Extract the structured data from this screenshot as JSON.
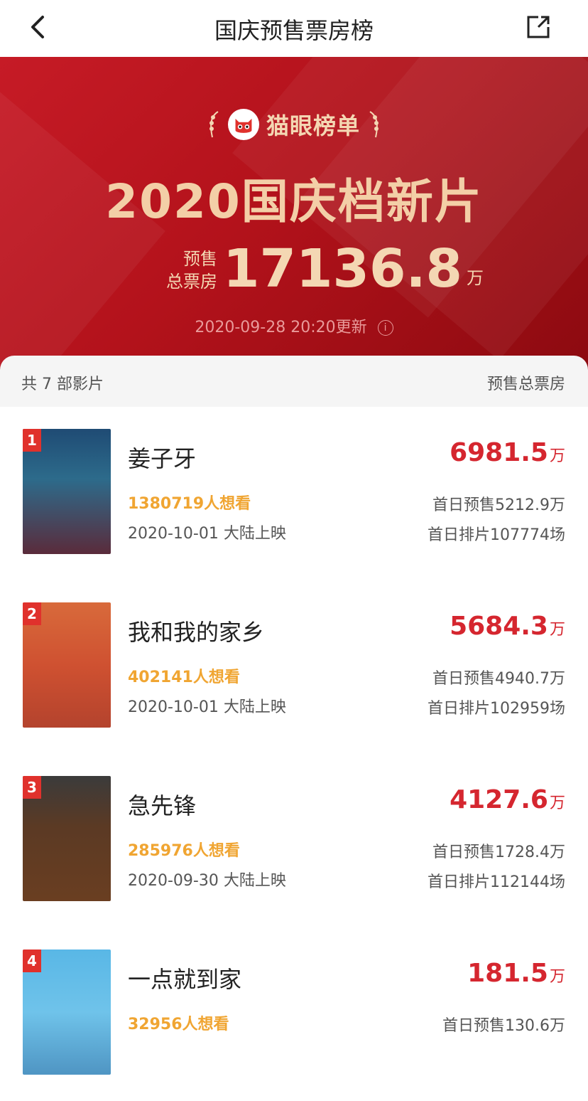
{
  "header": {
    "title": "国庆预售票房榜"
  },
  "banner": {
    "brand": "猫眼榜单",
    "headline": "2020国庆档新片",
    "presale_label_1": "预售",
    "presale_label_2": "总票房",
    "presale_value": "17136.8",
    "presale_unit": "万",
    "updated": "2020-09-28 20:20更新"
  },
  "summary": {
    "left": "共 7 部影片",
    "right": "预售总票房"
  },
  "movies": [
    {
      "rank": "1",
      "title": "姜子牙",
      "want": "1380719人想看",
      "release": "2020-10-01 大陆上映",
      "box": "6981.5",
      "unit": "万",
      "first_presale": "首日预售5212.9万",
      "first_sched": "首日排片107774场"
    },
    {
      "rank": "2",
      "title": "我和我的家乡",
      "want": "402141人想看",
      "release": "2020-10-01 大陆上映",
      "box": "5684.3",
      "unit": "万",
      "first_presale": "首日预售4940.7万",
      "first_sched": "首日排片102959场"
    },
    {
      "rank": "3",
      "title": "急先锋",
      "want": "285976人想看",
      "release": "2020-09-30 大陆上映",
      "box": "4127.6",
      "unit": "万",
      "first_presale": "首日预售1728.4万",
      "first_sched": "首日排片112144场"
    },
    {
      "rank": "4",
      "title": "一点就到家",
      "want": "32956人想看",
      "release": "",
      "box": "181.5",
      "unit": "万",
      "first_presale": "首日预售130.6万",
      "first_sched": ""
    }
  ],
  "colors": {
    "accent": "#d5262f",
    "gold": "#f4d7b3",
    "want": "#f0a532"
  }
}
